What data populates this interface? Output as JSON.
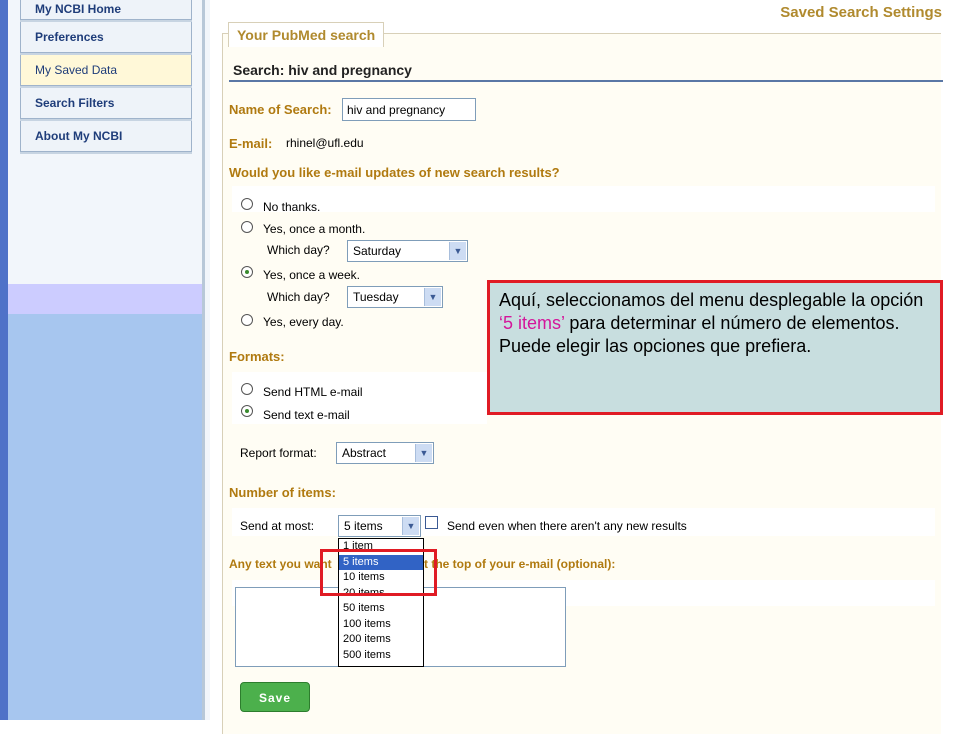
{
  "sidebar": {
    "items": [
      {
        "label": "My NCBI Home"
      },
      {
        "label": "Preferences"
      },
      {
        "label": "My Saved Data"
      },
      {
        "label": "Search Filters"
      },
      {
        "label": "About My NCBI"
      }
    ],
    "active_index": 2
  },
  "header": {
    "title": "Saved Search Settings"
  },
  "panel": {
    "tab_label": "Your PubMed search",
    "search_title": "Search: hiv and pregnancy"
  },
  "form": {
    "name_label": "Name of Search:",
    "name_value": "hiv and pregnancy",
    "email_label": "E-mail:",
    "email_value": "rhinel@ufl.edu",
    "updates_question": "Would you like e-mail updates of new search results?",
    "updates_options": [
      {
        "label": "No thanks.",
        "checked": false
      },
      {
        "label": "Yes, once a month.",
        "checked": false
      },
      {
        "label": "Yes, once a week.",
        "checked": true
      },
      {
        "label": "Yes, every day.",
        "checked": false
      }
    ],
    "which_day_label": "Which day?",
    "month_day_value": "Saturday",
    "week_day_value": "Tuesday",
    "formats_label": "Formats:",
    "format_options": [
      {
        "label": "Send HTML e-mail",
        "checked": false
      },
      {
        "label": "Send text e-mail",
        "checked": true
      }
    ],
    "report_format_label": "Report format:",
    "report_format_value": "Abstract",
    "number_items_label": "Number of items:",
    "send_at_most_label": "Send at most:",
    "send_at_most_value": "5 items",
    "send_even_label": "Send even when there aren't any new results",
    "send_even_checked": false,
    "items_options": [
      "1 item",
      "5 items",
      "10 items",
      "20 items",
      "50 items",
      "100 items",
      "200 items",
      "500 items"
    ],
    "items_selected_index": 1,
    "text_question_left": "Any text you want",
    "text_question_right": "t the top of your e-mail (optional):",
    "save_label": "Save"
  },
  "callout": {
    "text_before": "Aquí, seleccionamos del menu desplegable la opción ",
    "highlight": "‘5 items’",
    "text_after": " para determinar el número de elementos. Puede elegir las opciones que prefiera.",
    "highlight_color": "#d4169b",
    "border_color": "#e01b24"
  }
}
